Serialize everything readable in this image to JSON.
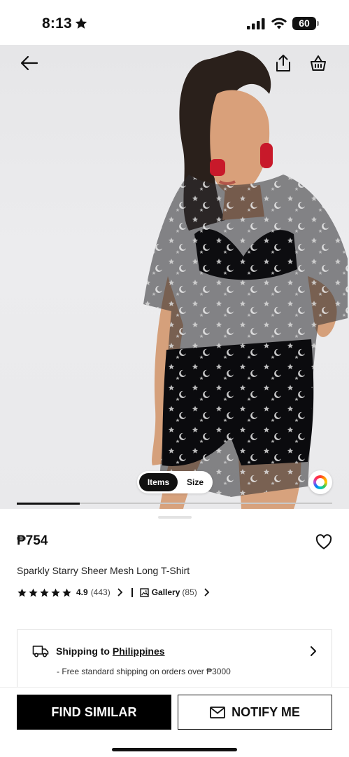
{
  "status_bar": {
    "time": "8:13",
    "battery": "60"
  },
  "gallery": {
    "tabs": {
      "items": "Items",
      "size": "Size"
    },
    "progress": 0.2
  },
  "product": {
    "price": "₱754",
    "title": "Sparkly Starry Sheer Mesh Long T-Shirt",
    "rating": {
      "value": "4.9",
      "count": "(443)",
      "stars": 5
    },
    "gallery_link": {
      "label": "Gallery",
      "count": "(85)"
    }
  },
  "shipping": {
    "prefix": "Shipping to",
    "country": "Philippines",
    "note": "- Free standard shipping on orders over ₱3000"
  },
  "actions": {
    "find_similar": "FIND SIMILAR",
    "notify_me": "NOTIFY ME"
  },
  "icons": {
    "back": "arrow-left-icon",
    "share": "share-icon",
    "cart": "shopping-bag-icon",
    "wishlist": "heart-icon",
    "truck": "truck-icon",
    "mail": "mail-icon"
  }
}
